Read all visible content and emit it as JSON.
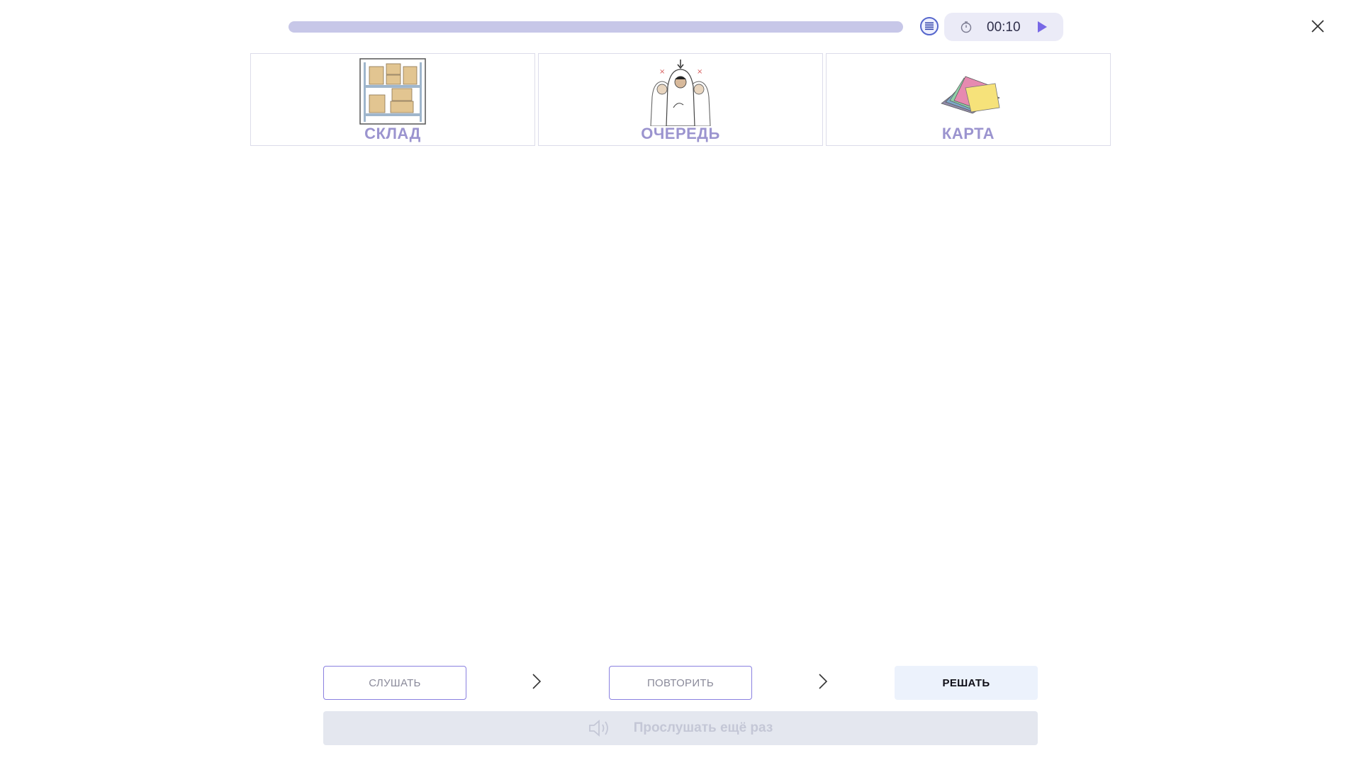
{
  "progress": {
    "fraction": 1.0
  },
  "timer": {
    "time": "00:10"
  },
  "cards": [
    {
      "label": "СКЛАД",
      "icon": "warehouse-shelves-image"
    },
    {
      "label": "ОЧЕРЕДЬ",
      "icon": "queue-people-image"
    },
    {
      "label": "КАРТА",
      "icon": "cards-stack-image"
    }
  ],
  "steps": {
    "listen": "СЛУШАТЬ",
    "repeat": "ПОВТОРИТЬ",
    "solve": "РЕШАТЬ"
  },
  "listen_again": {
    "label": "Прослушать ещё раз",
    "icon": "speaker-icon"
  },
  "colors": {
    "accent": "#8a80e0",
    "card_label": "#9b94cf",
    "active_step_bg": "#ecf2fc",
    "timer_bg": "#ebebf7",
    "play": "#7868e6"
  }
}
